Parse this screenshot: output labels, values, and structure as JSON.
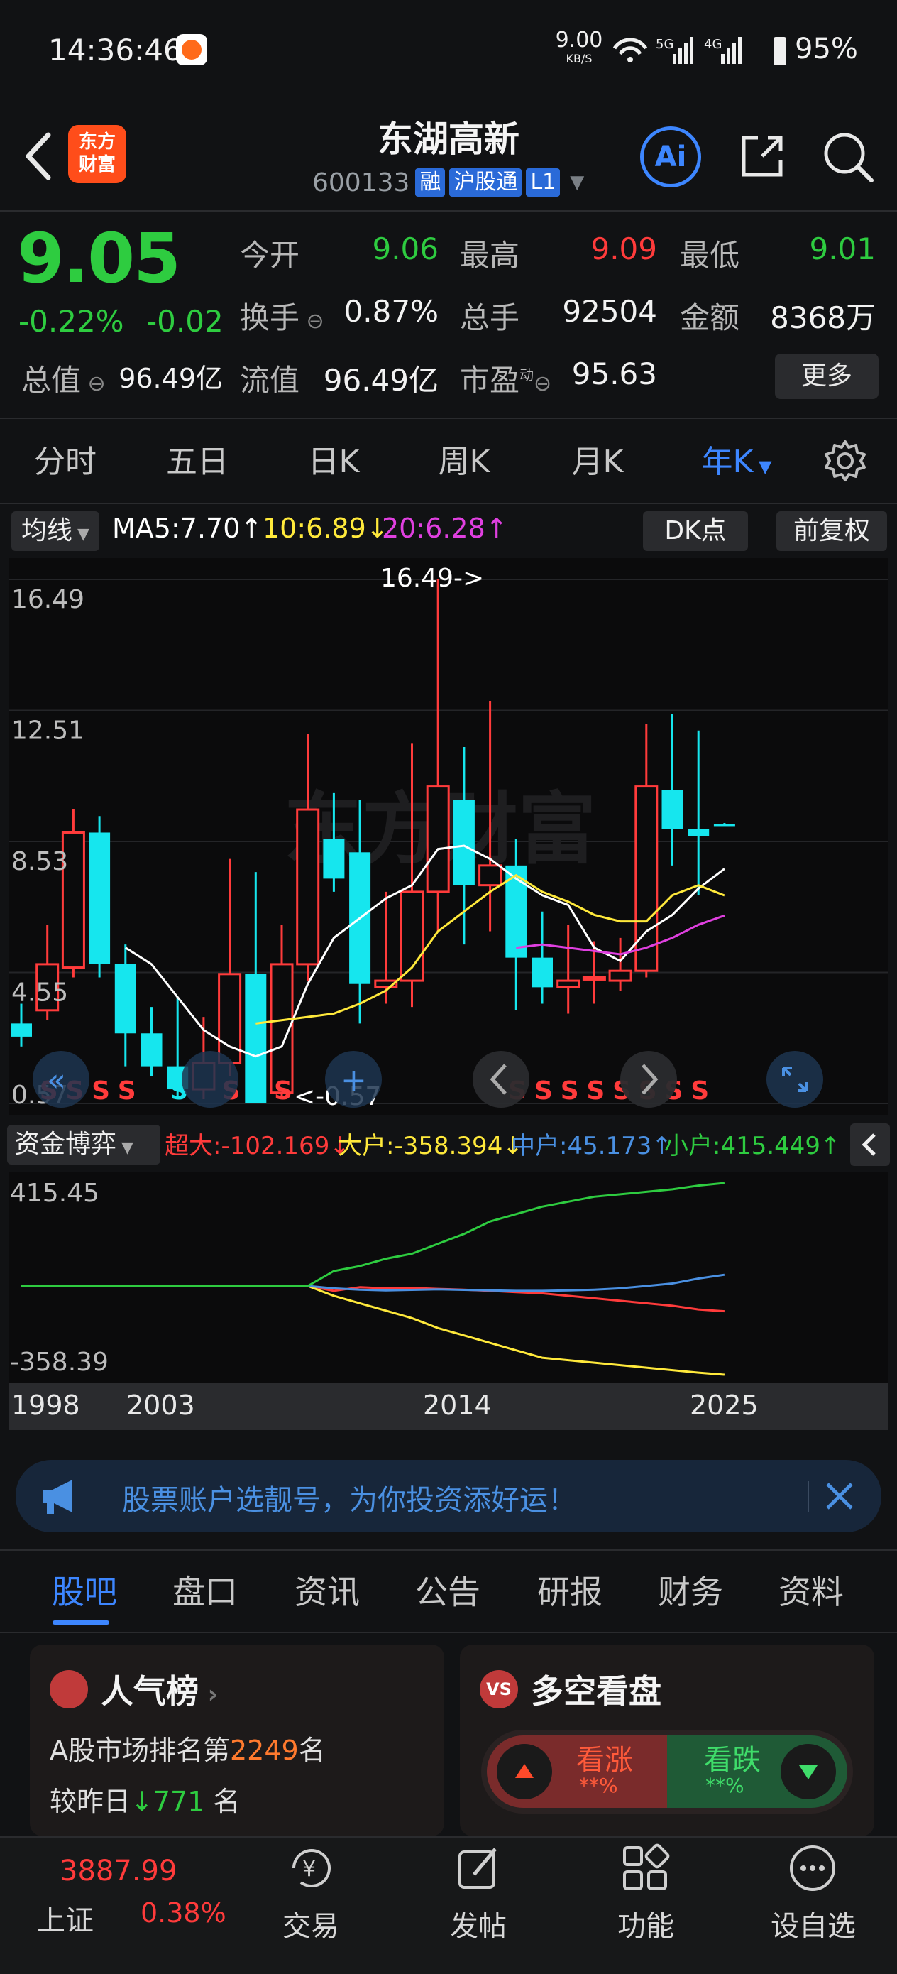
{
  "status_bar": {
    "time": "14:36:46",
    "speed_value": "9.00",
    "speed_unit": "KB/S",
    "network": "5G 4G",
    "battery": "95%"
  },
  "header": {
    "logo_text": "东方\n财富",
    "stock_name": "东湖高新",
    "stock_code": "600133",
    "tags": [
      "融",
      "沪股通",
      "L1"
    ],
    "ai_label": "Ai"
  },
  "quote": {
    "last_price": "9.05",
    "change_pct": "-0.22%",
    "change_val": "-0.02",
    "fields": [
      {
        "label": "今开",
        "value": "9.06",
        "color": "#2ecc40"
      },
      {
        "label": "最高",
        "value": "9.09",
        "color": "#ff3b3b"
      },
      {
        "label": "最低",
        "value": "9.01",
        "color": "#2ecc40"
      },
      {
        "label": "换手",
        "value": "0.87%",
        "color": "#f2f2f2"
      },
      {
        "label": "总手",
        "value": "92504",
        "color": "#f2f2f2"
      },
      {
        "label": "金额",
        "value": "8368万",
        "color": "#f2f2f2"
      },
      {
        "label": "总值",
        "value": "96.49亿",
        "color": "#f2f2f2"
      },
      {
        "label": "流值",
        "value": "96.49亿",
        "color": "#f2f2f2"
      },
      {
        "label": "市盈",
        "value": "95.63",
        "color": "#f2f2f2"
      }
    ],
    "pe_superscript": "动",
    "more_label": "更多"
  },
  "period_tabs": {
    "items": [
      "分时",
      "五日",
      "日K",
      "周K",
      "月K",
      "年K"
    ],
    "active": "年K"
  },
  "ma_legend": {
    "selector_label": "均线",
    "ma5": "MA5:7.70↑",
    "ma10": "10:6.89↓",
    "ma20": "20:6.28↑",
    "dk_label": "DK点",
    "adjust_label": "前复权"
  },
  "chart_data": [
    {
      "type": "candlestick",
      "title": "",
      "y_ticks": [
        "16.49",
        "12.51",
        "8.53",
        "4.55",
        "0.57"
      ],
      "ylim": [
        0.57,
        16.49
      ],
      "max_label": "16.49->",
      "min_label": "<-0.57",
      "candles": [
        {
          "year": 1998,
          "open": 3.0,
          "close": 2.6,
          "high": 3.6,
          "low": 2.3
        },
        {
          "year": 1999,
          "open": 3.4,
          "close": 4.8,
          "high": 6.0,
          "low": 3.1
        },
        {
          "year": 2000,
          "open": 4.7,
          "close": 8.8,
          "high": 9.5,
          "low": 4.4
        },
        {
          "year": 2001,
          "open": 8.8,
          "close": 4.8,
          "high": 9.3,
          "low": 4.4
        },
        {
          "year": 2002,
          "open": 4.8,
          "close": 2.7,
          "high": 5.4,
          "low": 1.7
        },
        {
          "year": 2003,
          "open": 2.7,
          "close": 1.7,
          "high": 3.5,
          "low": 1.4
        },
        {
          "year": 2004,
          "open": 1.7,
          "close": 1.0,
          "high": 3.8,
          "low": 0.7
        },
        {
          "year": 2005,
          "open": 1.0,
          "close": 1.8,
          "high": 3.2,
          "low": 0.7
        },
        {
          "year": 2006,
          "open": 1.8,
          "close": 4.5,
          "high": 8.0,
          "low": 1.4
        },
        {
          "year": 2007,
          "open": 4.5,
          "close": 0.57,
          "high": 7.6,
          "low": 0.57
        },
        {
          "year": 2008,
          "open": 0.9,
          "close": 4.8,
          "high": 6.0,
          "low": 0.7
        },
        {
          "year": 2009,
          "open": 4.8,
          "close": 9.5,
          "high": 11.8,
          "low": 4.3
        },
        {
          "year": 2010,
          "open": 8.6,
          "close": 7.4,
          "high": 10.0,
          "low": 7.0
        },
        {
          "year": 2011,
          "open": 8.2,
          "close": 4.2,
          "high": 9.8,
          "low": 3.0
        },
        {
          "year": 2012,
          "open": 4.1,
          "close": 4.3,
          "high": 7.0,
          "low": 3.6
        },
        {
          "year": 2013,
          "open": 4.3,
          "close": 7.0,
          "high": 11.5,
          "low": 3.5
        },
        {
          "year": 2014,
          "open": 7.0,
          "close": 10.2,
          "high": 16.49,
          "low": 5.8
        },
        {
          "year": 2015,
          "open": 9.8,
          "close": 7.2,
          "high": 11.4,
          "low": 5.4
        },
        {
          "year": 2016,
          "open": 7.2,
          "close": 7.8,
          "high": 12.8,
          "low": 5.8
        },
        {
          "year": 2017,
          "open": 7.8,
          "close": 5.0,
          "high": 8.6,
          "low": 3.4
        },
        {
          "year": 2018,
          "open": 5.0,
          "close": 4.1,
          "high": 6.4,
          "low": 3.6
        },
        {
          "year": 2019,
          "open": 4.1,
          "close": 4.3,
          "high": 6.0,
          "low": 3.3
        },
        {
          "year": 2020,
          "open": 4.4,
          "close": 4.4,
          "high": 5.5,
          "low": 3.6
        },
        {
          "year": 2021,
          "open": 4.3,
          "close": 4.6,
          "high": 5.6,
          "low": 4.0
        },
        {
          "year": 2022,
          "open": 4.6,
          "close": 10.2,
          "high": 12.1,
          "low": 4.4
        },
        {
          "year": 2023,
          "open": 10.1,
          "close": 8.9,
          "high": 12.4,
          "low": 7.8
        },
        {
          "year": 2024,
          "open": 8.9,
          "close": 8.7,
          "high": 11.9,
          "low": 6.9
        },
        {
          "year": 2025,
          "open": 9.06,
          "close": 9.05,
          "high": 9.09,
          "low": 9.01
        }
      ],
      "ma5": [
        null,
        null,
        null,
        null,
        5.3,
        4.8,
        3.8,
        2.8,
        2.3,
        2.0,
        2.3,
        4.2,
        5.6,
        6.2,
        6.8,
        7.2,
        8.3,
        8.4,
        8.0,
        7.4,
        6.9,
        6.6,
        5.3,
        4.9,
        5.8,
        6.3,
        7.1,
        7.7
      ],
      "ma10": [
        null,
        null,
        null,
        null,
        null,
        null,
        null,
        null,
        null,
        3.0,
        3.1,
        3.2,
        3.3,
        3.6,
        4.0,
        4.7,
        5.8,
        6.4,
        7.0,
        7.5,
        7.0,
        6.7,
        6.3,
        6.1,
        6.1,
        6.9,
        7.2,
        6.89
      ],
      "ma20": [
        null,
        null,
        null,
        null,
        null,
        null,
        null,
        null,
        null,
        null,
        null,
        null,
        null,
        null,
        null,
        null,
        null,
        null,
        null,
        5.3,
        5.4,
        5.3,
        5.2,
        5.1,
        5.3,
        5.6,
        6.0,
        6.28
      ],
      "signals": [
        "S",
        "S",
        "S",
        "S",
        "S",
        "S",
        "S",
        "S",
        "S",
        "S",
        "S",
        "S",
        "S",
        "S",
        "S",
        "S",
        "S"
      ]
    },
    {
      "type": "line",
      "title": "",
      "y_ticks": [
        "415.45",
        "-358.39"
      ],
      "ylim": [
        -358.39,
        415.45
      ],
      "x_ticks": [
        "1998",
        "2003",
        "2014",
        "2025"
      ],
      "series": [
        {
          "name": "超大",
          "color": "#ff3b3b",
          "values": [
            0,
            0,
            0,
            0,
            0,
            0,
            0,
            0,
            0,
            0,
            0,
            0,
            -20,
            -5,
            -10,
            -8,
            -12,
            -15,
            -20,
            -25,
            -30,
            -40,
            -50,
            -60,
            -70,
            -80,
            -95,
            -102.169
          ]
        },
        {
          "name": "大户",
          "color": "#ffe93b",
          "values": [
            0,
            0,
            0,
            0,
            0,
            0,
            0,
            0,
            0,
            0,
            0,
            0,
            -40,
            -70,
            -100,
            -130,
            -170,
            -200,
            -230,
            -260,
            -290,
            -300,
            -310,
            -320,
            -330,
            -340,
            -350,
            -358.394
          ]
        },
        {
          "name": "中户",
          "color": "#4a90e2",
          "values": [
            0,
            0,
            0,
            0,
            0,
            0,
            0,
            0,
            0,
            0,
            0,
            0,
            -10,
            -15,
            -18,
            -16,
            -14,
            -16,
            -18,
            -20,
            -20,
            -18,
            -15,
            -10,
            0,
            10,
            30,
            45.173
          ]
        },
        {
          "name": "小户",
          "color": "#2ecc40",
          "values": [
            0,
            0,
            0,
            0,
            0,
            0,
            0,
            0,
            0,
            0,
            0,
            0,
            60,
            80,
            110,
            130,
            170,
            210,
            260,
            290,
            320,
            340,
            360,
            370,
            380,
            390,
            405,
            415.449
          ]
        }
      ]
    }
  ],
  "fund_flow": {
    "selector_label": "资金博弈",
    "super": "超大:-102.169↓",
    "large": "大户:-358.394↓",
    "mid": "中户:45.173↑",
    "small": "小户:415.449↑"
  },
  "ad_banner": {
    "text": "股票账户选靓号，为你投资添好运！"
  },
  "bottom_tabs": {
    "items": [
      "股吧",
      "盘口",
      "资讯",
      "公告",
      "研报",
      "财务",
      "资料"
    ],
    "active": "股吧"
  },
  "cards": {
    "popularity": {
      "title": "人气榜",
      "rank_prefix": "A股市场排名第",
      "rank": "2249",
      "rank_suffix": "名",
      "change_prefix": "较昨日",
      "change_value": "771",
      "change_suffix": "名"
    },
    "bull_bear": {
      "title": "多空看盘",
      "bull_label": "看涨",
      "bull_value": "**%",
      "bear_label": "看跌",
      "bear_value": "**%",
      "icon_text": "VS"
    }
  },
  "bottom_nav": {
    "index_value": "3887.99",
    "index_name": "上证",
    "index_change": "0.38%",
    "items": [
      "交易",
      "发帖",
      "功能",
      "设自选"
    ]
  }
}
